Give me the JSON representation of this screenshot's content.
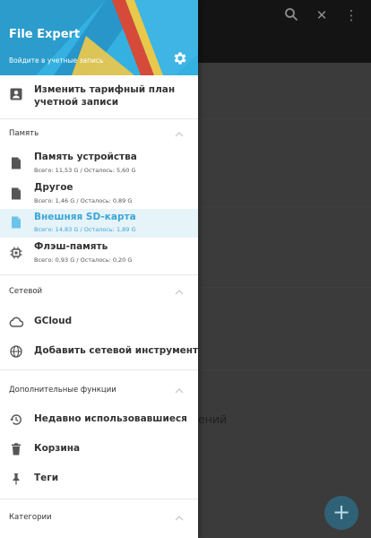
{
  "background": {
    "partial_text": "ений",
    "fab_label": "+"
  },
  "drawer": {
    "app_title": "File Expert",
    "login_prompt": "Войдите в учетные запись",
    "upgrade_label": "Изменить тарифный план учетной записи",
    "sections": {
      "memory": "Память",
      "network": "Сетевой",
      "extras": "Дополнительные функции",
      "categories": "Категории"
    },
    "storage": [
      {
        "label": "Память устройства",
        "details": "Всего: 11,53 G / Осталось: 5,60 G"
      },
      {
        "label": "Другое",
        "details": "Всего: 1,46 G / Осталось: 0,89 G"
      },
      {
        "label": "Внешняя SD-карта",
        "details": "Всего: 14,83 G / Осталось: 1,89 G"
      },
      {
        "label": "Флэш-память",
        "details": "Всего: 0,93 G / Осталось: 0,20 G"
      }
    ],
    "network": [
      {
        "label": "GCloud"
      },
      {
        "label": "Добавить сетевой инструмент"
      }
    ],
    "extras": [
      {
        "label": "Недавно использовавшиеся"
      },
      {
        "label": "Корзина"
      },
      {
        "label": "Теги"
      }
    ]
  },
  "colors": {
    "accent": "#34b1e0",
    "selected_bg": "#e6f3f8",
    "selected_text": "#3aa5d8"
  }
}
